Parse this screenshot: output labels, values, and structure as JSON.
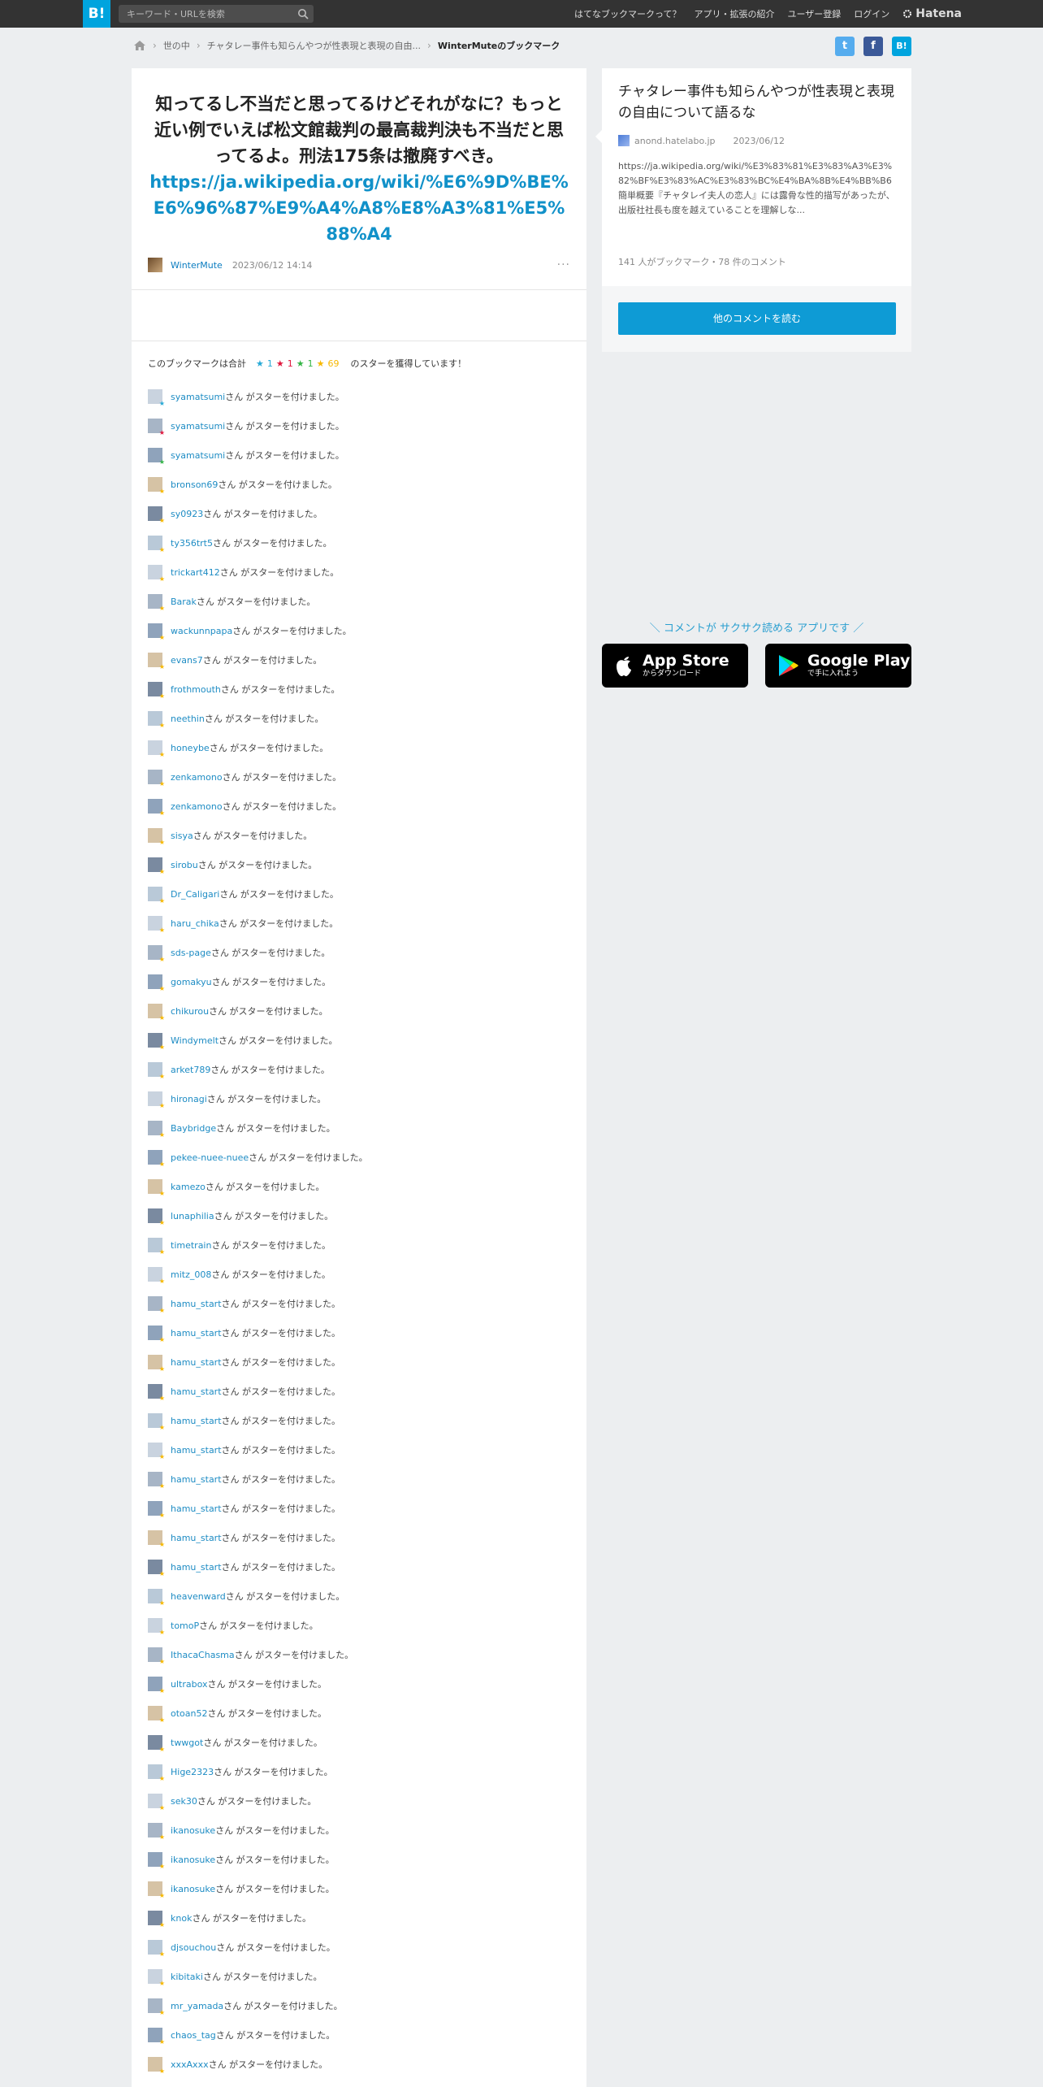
{
  "header": {
    "logo": "B!",
    "search_placeholder": "キーワード・URLを検索",
    "nav": [
      "はてなブックマークって？",
      "アプリ・拡張の紹介",
      "ユーザー登録",
      "ログイン"
    ],
    "brand": "Hatena"
  },
  "breadcrumb": {
    "items": [
      "世の中",
      "チャタレー事件も知らんやつが性表現と表現の自由...",
      "WinterMuteのブックマーク"
    ]
  },
  "share": {
    "twitter": "t",
    "facebook": "f",
    "hatena": "B!"
  },
  "comment": {
    "text": "知ってるし不当だと思ってるけどそれがなに？もっと近い例でいえば松文館裁判の最高裁判決も不当だと思ってるよ。刑法175条は撤廃すべき。",
    "url": "https://ja.wikipedia.org/wiki/%E6%9D%BE%E6%96%87%E9%A4%A8%E8%A3%81%E5%88%A4",
    "user": "WinterMute",
    "date": "2023/06/12 14:14",
    "more": "···"
  },
  "stars_summary": {
    "prefix": "このブックマークは合計",
    "blue": "1",
    "red": "1",
    "green": "1",
    "yellow": "69",
    "suffix": "のスターを獲得しています！"
  },
  "colors": {
    "blue": "#26a9d6",
    "red": "#e0163c",
    "green": "#33b545",
    "yellow": "#f7b800",
    "accent": "#00a4de"
  },
  "star_suffix": "さん がスターを付けました。",
  "stars": [
    {
      "user": "syamatsumi",
      "color": "blue"
    },
    {
      "user": "syamatsumi",
      "color": "red"
    },
    {
      "user": "syamatsumi",
      "color": "green"
    },
    {
      "user": "bronson69",
      "color": "yellow"
    },
    {
      "user": "sy0923",
      "color": "yellow"
    },
    {
      "user": "ty356trt5",
      "color": "yellow"
    },
    {
      "user": "trickart412",
      "color": "yellow"
    },
    {
      "user": "Barak",
      "color": "yellow"
    },
    {
      "user": "wackunnpapa",
      "color": "yellow"
    },
    {
      "user": "evans7",
      "color": "yellow"
    },
    {
      "user": "frothmouth",
      "color": "yellow"
    },
    {
      "user": "neethin",
      "color": "yellow"
    },
    {
      "user": "honeybe",
      "color": "yellow"
    },
    {
      "user": "zenkamono",
      "color": "yellow"
    },
    {
      "user": "zenkamono",
      "color": "yellow"
    },
    {
      "user": "sisya",
      "color": "yellow"
    },
    {
      "user": "sirobu",
      "color": "yellow"
    },
    {
      "user": "Dr_Caligari",
      "color": "yellow"
    },
    {
      "user": "haru_chika",
      "color": "yellow"
    },
    {
      "user": "sds-page",
      "color": "yellow"
    },
    {
      "user": "gomakyu",
      "color": "yellow"
    },
    {
      "user": "chikurou",
      "color": "yellow"
    },
    {
      "user": "Windymelt",
      "color": "yellow"
    },
    {
      "user": "arket789",
      "color": "yellow"
    },
    {
      "user": "hironagi",
      "color": "yellow"
    },
    {
      "user": "Baybridge",
      "color": "yellow"
    },
    {
      "user": "pekee-nuee-nuee",
      "color": "yellow"
    },
    {
      "user": "kamezo",
      "color": "yellow"
    },
    {
      "user": "lunaphilia",
      "color": "yellow"
    },
    {
      "user": "timetrain",
      "color": "yellow"
    },
    {
      "user": "mitz_008",
      "color": "yellow"
    },
    {
      "user": "hamu_start",
      "color": "yellow"
    },
    {
      "user": "hamu_start",
      "color": "yellow"
    },
    {
      "user": "hamu_start",
      "color": "yellow"
    },
    {
      "user": "hamu_start",
      "color": "yellow"
    },
    {
      "user": "hamu_start",
      "color": "yellow"
    },
    {
      "user": "hamu_start",
      "color": "yellow"
    },
    {
      "user": "hamu_start",
      "color": "yellow"
    },
    {
      "user": "hamu_start",
      "color": "yellow"
    },
    {
      "user": "hamu_start",
      "color": "yellow"
    },
    {
      "user": "hamu_start",
      "color": "yellow"
    },
    {
      "user": "heavenward",
      "color": "yellow"
    },
    {
      "user": "tomoP",
      "color": "yellow"
    },
    {
      "user": "IthacaChasma",
      "color": "yellow"
    },
    {
      "user": "ultrabox",
      "color": "yellow"
    },
    {
      "user": "otoan52",
      "color": "yellow"
    },
    {
      "user": "twwgot",
      "color": "yellow"
    },
    {
      "user": "Hige2323",
      "color": "yellow"
    },
    {
      "user": "sek30",
      "color": "yellow"
    },
    {
      "user": "ikanosuke",
      "color": "yellow"
    },
    {
      "user": "ikanosuke",
      "color": "yellow"
    },
    {
      "user": "ikanosuke",
      "color": "yellow"
    },
    {
      "user": "knok",
      "color": "yellow"
    },
    {
      "user": "djsouchou",
      "color": "yellow"
    },
    {
      "user": "kibitaki",
      "color": "yellow"
    },
    {
      "user": "mr_yamada",
      "color": "yellow"
    },
    {
      "user": "chaos_tag",
      "color": "yellow"
    },
    {
      "user": "xxxAxxx",
      "color": "yellow"
    }
  ],
  "entry": {
    "title": "チャタレー事件も知らんやつが性表現と表現の自由について語るな",
    "domain": "anond.hatelabo.jp",
    "date": "2023/06/12",
    "description": "https://ja.wikipedia.org/wiki/%E3%83%81%E3%83%A3%E3%82%BF%E3%83%AC%E3%83%BC%E4%BA%8B%E4%BB%B6 簡単概要『チャタレイ夫人の恋人』には露骨な性的描写があったが、出版社社長も度を越えていることを理解しな...",
    "stats": "141 人がブックマーク・78 件のコメント",
    "more_button": "他のコメントを読む"
  },
  "app_promo": {
    "text": "＼ コメントが サクサク読める アプリです ／",
    "appstore_big": "App Store",
    "appstore_small": "からダウンロード",
    "gplay_big": "Google Play",
    "gplay_small": "で手に入れよう"
  }
}
